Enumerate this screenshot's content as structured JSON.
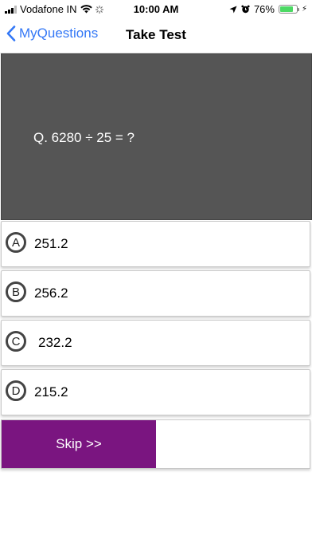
{
  "status_bar": {
    "carrier": "Vodafone IN",
    "time": "10:00 AM",
    "battery": "76%",
    "battery_level": 0.76
  },
  "nav": {
    "back_label": "MyQuestions",
    "title": "Take Test"
  },
  "question": {
    "text": "Q. 6280 ÷ 25 = ?"
  },
  "options": [
    {
      "letter": "A",
      "value": "251.2"
    },
    {
      "letter": "B",
      "value": "256.2"
    },
    {
      "letter": "C",
      "value": "232.2"
    },
    {
      "letter": "D",
      "value": "215.2"
    }
  ],
  "skip": {
    "label": "Skip >>"
  },
  "colors": {
    "accent": "#3478f6",
    "question_bg": "#555555",
    "skip_bg": "#7a1580"
  }
}
